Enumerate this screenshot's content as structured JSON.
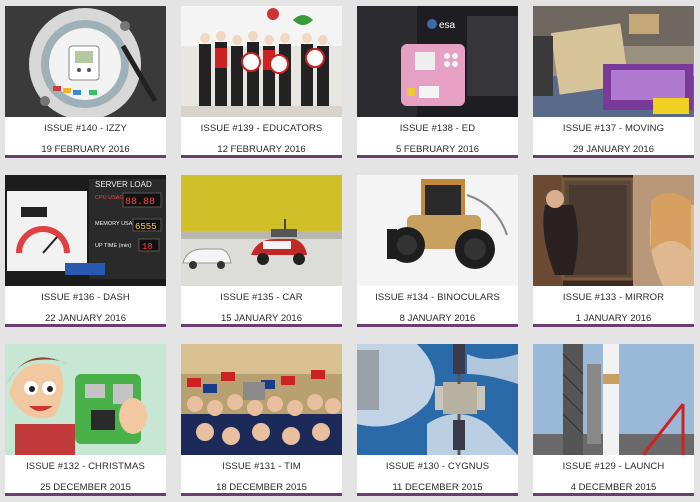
{
  "issues": [
    {
      "title": "ISSUE #140 - IZZY",
      "date": "19 FEBRUARY 2016"
    },
    {
      "title": "ISSUE #139 - EDUCATORS",
      "date": "12 FEBRUARY 2016"
    },
    {
      "title": "ISSUE #138 - ED",
      "date": "5 FEBRUARY 2016"
    },
    {
      "title": "ISSUE #137 - MOVING",
      "date": "29 JANUARY 2016"
    },
    {
      "title": "ISSUE #136 - DASH",
      "date": "22 JANUARY 2016"
    },
    {
      "title": "ISSUE #135 - CAR",
      "date": "15 JANUARY 2016"
    },
    {
      "title": "ISSUE #134 - BINOCULARS",
      "date": "8 JANUARY 2016"
    },
    {
      "title": "ISSUE #133 - MIRROR",
      "date": "1 JANUARY 2016"
    },
    {
      "title": "ISSUE #132 - CHRISTMAS",
      "date": "25 DECEMBER 2015"
    },
    {
      "title": "ISSUE #131 - TIM",
      "date": "18 DECEMBER 2015"
    },
    {
      "title": "ISSUE #130 - CYGNUS",
      "date": "11 DECEMBER 2015"
    },
    {
      "title": "ISSUE #129 - LAUNCH",
      "date": "4 DECEMBER 2015"
    }
  ],
  "thumb_text": {
    "server_load": "SERVER LOAD",
    "cpu_usage": "CPU USAGE",
    "cpu_value": "88.88",
    "memory_usage": "MEMORY USAGE",
    "memory_value": "6555",
    "up_time": "UP TIME (min)",
    "up_time_value": "18",
    "esa_logo": "esa"
  },
  "colors": {
    "card_underline": "#6a3f6f",
    "background": "#e4e4e4"
  }
}
